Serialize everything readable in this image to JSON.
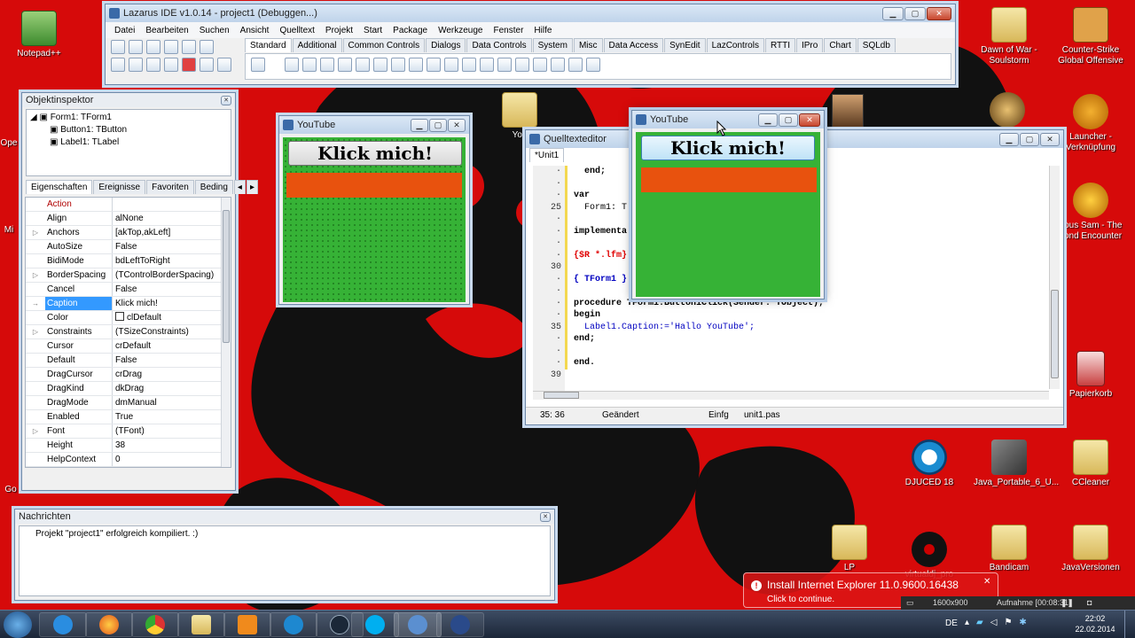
{
  "desktop": {
    "icons_left": [
      {
        "label": "Notepad++"
      },
      {
        "label": "Ope"
      },
      {
        "label": "Mi"
      },
      {
        "label": "Go"
      }
    ],
    "icons_right": [
      {
        "label": "Dawn of War - Soulstorm"
      },
      {
        "label": "Counter-Strike Global Offensive"
      },
      {
        "label": "Launcher - Verknüpfung"
      },
      {
        "label": "rious Sam - The cond Encounter"
      },
      {
        "label": "Papierkorb"
      },
      {
        "label": "DJUCED 18"
      },
      {
        "label": "Java_Portable_6_U..."
      },
      {
        "label": "CCleaner"
      },
      {
        "label": "LP"
      },
      {
        "label": "virtualdj_pro"
      },
      {
        "label": "Bandicam"
      },
      {
        "label": "JavaVersionen"
      },
      {
        "label": "You"
      }
    ]
  },
  "ide": {
    "title": "Lazarus IDE v1.0.14 - project1 (Debuggen...)",
    "menu": [
      "Datei",
      "Bearbeiten",
      "Suchen",
      "Ansicht",
      "Quelltext",
      "Projekt",
      "Start",
      "Package",
      "Werkzeuge",
      "Fenster",
      "Hilfe"
    ],
    "palette_tabs": [
      "Standard",
      "Additional",
      "Common Controls",
      "Dialogs",
      "Data Controls",
      "System",
      "Misc",
      "Data Access",
      "SynEdit",
      "LazControls",
      "RTTI",
      "IPro",
      "Chart",
      "SQLdb"
    ]
  },
  "inspector": {
    "title": "Objektinspektor",
    "tree": [
      "Form1: TForm1",
      "Button1: TButton",
      "Label1: TLabel"
    ],
    "tabs": [
      "Eigenschaften",
      "Ereignisse",
      "Favoriten",
      "Beding"
    ],
    "properties": [
      {
        "name": "Action",
        "value": "",
        "expand": ""
      },
      {
        "name": "Align",
        "value": "alNone",
        "expand": ""
      },
      {
        "name": "Anchors",
        "value": "[akTop,akLeft]",
        "expand": "▷"
      },
      {
        "name": "AutoSize",
        "value": "False",
        "expand": ""
      },
      {
        "name": "BidiMode",
        "value": "bdLeftToRight",
        "expand": ""
      },
      {
        "name": "BorderSpacing",
        "value": "(TControlBorderSpacing)",
        "expand": "▷"
      },
      {
        "name": "Cancel",
        "value": "False",
        "expand": ""
      },
      {
        "name": "Caption",
        "value": "Klick mich!",
        "expand": "→"
      },
      {
        "name": "Color",
        "value": "clDefault",
        "expand": ""
      },
      {
        "name": "Constraints",
        "value": "(TSizeConstraints)",
        "expand": "▷"
      },
      {
        "name": "Cursor",
        "value": "crDefault",
        "expand": ""
      },
      {
        "name": "Default",
        "value": "False",
        "expand": ""
      },
      {
        "name": "DragCursor",
        "value": "crDrag",
        "expand": ""
      },
      {
        "name": "DragKind",
        "value": "dkDrag",
        "expand": ""
      },
      {
        "name": "DragMode",
        "value": "dmManual",
        "expand": ""
      },
      {
        "name": "Enabled",
        "value": "True",
        "expand": ""
      },
      {
        "name": "Font",
        "value": "(TFont)",
        "expand": "▷"
      },
      {
        "name": "Height",
        "value": "38",
        "expand": ""
      },
      {
        "name": "HelpContext",
        "value": "0",
        "expand": ""
      }
    ]
  },
  "messages": {
    "title": "Nachrichten",
    "text": "Projekt \"project1\" erfolgreich kompiliert. :)"
  },
  "form_design": {
    "title": "YouTube",
    "button_caption": "Klick mich!"
  },
  "form_running": {
    "title": "YouTube",
    "button_caption": "Klick mich!"
  },
  "editor": {
    "title": "Quelltexteditor",
    "tab": "*Unit1",
    "lines": [
      {
        "num": "",
        "text": "  end;"
      },
      {
        "num": "",
        "text": ""
      },
      {
        "num": "",
        "text": "var"
      },
      {
        "num": "25",
        "text": "  Form1: T"
      },
      {
        "num": "",
        "text": ""
      },
      {
        "num": "",
        "text": "implementa"
      },
      {
        "num": "",
        "text": ""
      },
      {
        "num": "",
        "text": "{$R *.lfm}"
      },
      {
        "num": "30",
        "text": ""
      },
      {
        "num": "",
        "text": "{ TForm1 }"
      },
      {
        "num": "",
        "text": ""
      },
      {
        "num": "",
        "text": "procedure TForm1.Button1Click(Sender: TObject);"
      },
      {
        "num": "",
        "text": "begin"
      },
      {
        "num": "35",
        "text": "  Label1.Caption:='Hallo YouTube';"
      },
      {
        "num": "",
        "text": "end;"
      },
      {
        "num": "",
        "text": ""
      },
      {
        "num": "",
        "text": "end."
      },
      {
        "num": "39",
        "text": ""
      }
    ],
    "status": {
      "pos": "35: 36",
      "state": "Geändert",
      "mode": "Einfg",
      "file": "unit1.pas"
    }
  },
  "notification": {
    "title": "Install Internet Explorer 11.0.9600.16438",
    "sub": "Click to continue."
  },
  "recorder": {
    "resolution": "1600x900",
    "label": "Aufnahme [00:08:31]"
  },
  "tray": {
    "lang": "DE",
    "time": "22:02",
    "date": "22.02.2014"
  },
  "colors": {
    "wallpaper_red": "#d60a0a",
    "form_green": "#36b236",
    "label_orange": "#e8520e",
    "selection_blue": "#3399ff"
  }
}
